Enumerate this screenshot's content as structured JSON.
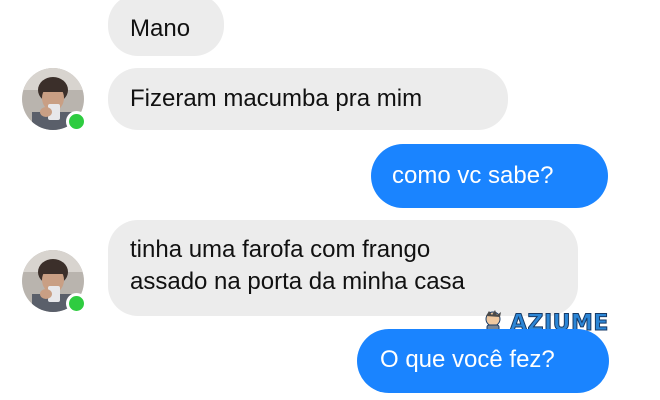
{
  "messages": [
    {
      "from": "contact",
      "text": "Mano"
    },
    {
      "from": "contact",
      "text": "Fizeram macumba pra mim"
    },
    {
      "from": "me",
      "text": "como vc sabe?"
    },
    {
      "from": "contact",
      "text": "tinha uma farofa com frango\nassado na porta da minha casa"
    },
    {
      "from": "me",
      "text": "O que você fez?"
    }
  ],
  "contact": {
    "avatar_icon": "user-photo-avatar",
    "status": "online",
    "status_color": "#2ecc40"
  },
  "colors": {
    "incoming_bubble": "#ececec",
    "outgoing_bubble": "#1a84ff",
    "outgoing_text": "#ffffff"
  },
  "watermark": {
    "text": "AZIUME",
    "icon": "aziume-mascot-logo"
  }
}
